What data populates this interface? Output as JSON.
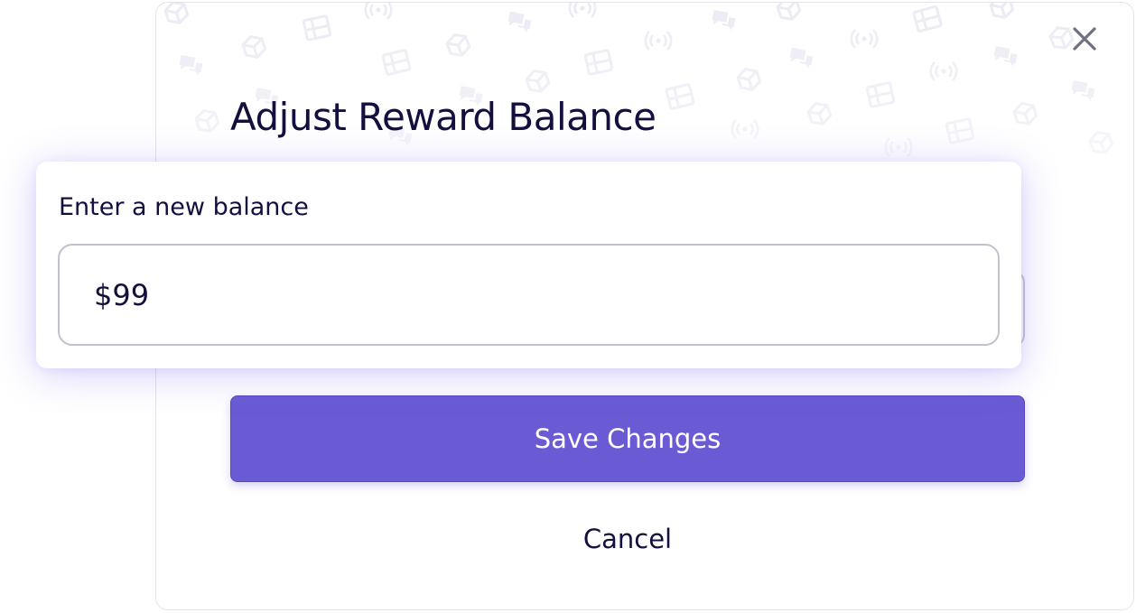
{
  "modal": {
    "title": "Adjust Reward Balance",
    "save_label": "Save Changes",
    "cancel_label": "Cancel",
    "close_icon": "close-icon",
    "pattern_icons": [
      "box-icon",
      "chat-icon",
      "film-icon",
      "signal-icon"
    ]
  },
  "popover": {
    "label": "Enter a new balance",
    "balance_value": "$99"
  },
  "colors": {
    "accent": "#6a5bd4",
    "text_dark": "#13103f",
    "pattern": "#eeecf5",
    "close": "#6f7182"
  }
}
